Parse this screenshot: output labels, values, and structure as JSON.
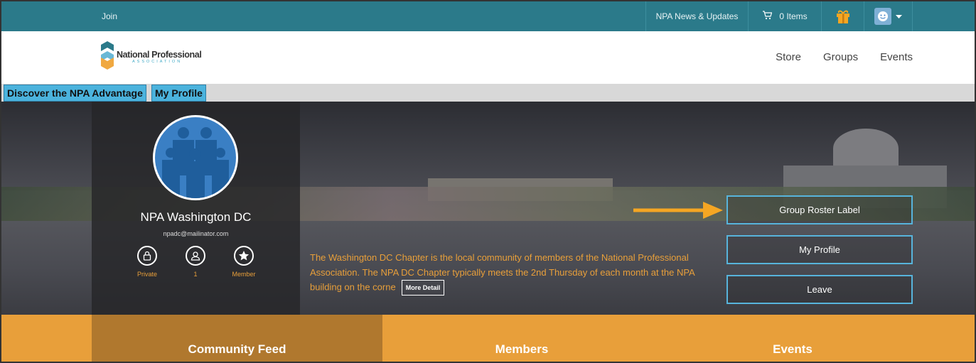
{
  "topbar": {
    "join": "Join",
    "news": "NPA News & Updates",
    "cart_label": "0 Items",
    "gift_icon": "gift-icon",
    "user_icon": "smiley-icon"
  },
  "header": {
    "logo_name": "National Professional",
    "logo_sub": "ASSOCIATION",
    "nav": [
      "Store",
      "Groups",
      "Events"
    ]
  },
  "subnav": {
    "discover": "Discover the NPA Advantage",
    "my_profile": "My Profile"
  },
  "group": {
    "name": "NPA Washington DC",
    "email": "npadc@mailinator.com",
    "stats": [
      {
        "label": "Private",
        "icon": "lock-icon"
      },
      {
        "label": "1",
        "icon": "user-icon"
      },
      {
        "label": "Member",
        "icon": "star-icon"
      }
    ],
    "description": "The Washington DC Chapter is the local community of members of the National Professional Association. The NPA DC Chapter typically meets the 2nd Thursday of each month at the NPA building on the corne",
    "more_detail": "More Detail"
  },
  "actions": {
    "roster": "Group Roster Label",
    "profile": "My Profile",
    "leave": "Leave"
  },
  "tabs": [
    "Community Feed",
    "Members",
    "Events"
  ],
  "colors": {
    "topbar": "#2b7a8a",
    "accent": "#e89f3a",
    "tab_active": "#b0782e",
    "button_border": "#57b4dc"
  }
}
